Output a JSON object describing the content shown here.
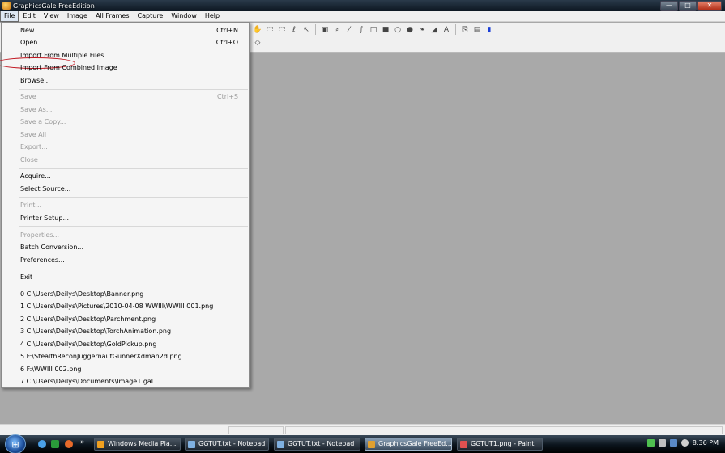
{
  "window": {
    "title": "GraphicsGale FreeEdition",
    "buttons": {
      "minimize": "—",
      "maximize": "□",
      "close": "✕"
    }
  },
  "menubar": {
    "items": [
      "File",
      "Edit",
      "View",
      "Image",
      "All Frames",
      "Capture",
      "Window",
      "Help"
    ]
  },
  "file_menu": {
    "items": [
      {
        "label": "New...",
        "shortcut": "Ctrl+N",
        "enabled": true
      },
      {
        "label": "Open...",
        "shortcut": "Ctrl+O",
        "enabled": true
      },
      {
        "label": "Import From Multiple Files",
        "shortcut": "",
        "enabled": true
      },
      {
        "label": "Import From Combined Image",
        "shortcut": "",
        "enabled": true
      },
      {
        "label": "Browse...",
        "shortcut": "",
        "enabled": true
      },
      {
        "label": "Save",
        "shortcut": "Ctrl+S",
        "enabled": false
      },
      {
        "label": "Save As...",
        "shortcut": "",
        "enabled": false
      },
      {
        "label": "Save a Copy...",
        "shortcut": "",
        "enabled": false
      },
      {
        "label": "Save All",
        "shortcut": "",
        "enabled": false
      },
      {
        "label": "Export...",
        "shortcut": "",
        "enabled": false
      },
      {
        "label": "Close",
        "shortcut": "",
        "enabled": false
      },
      {
        "label": "Acquire...",
        "shortcut": "",
        "enabled": true
      },
      {
        "label": "Select Source...",
        "shortcut": "",
        "enabled": true
      },
      {
        "label": "Print...",
        "shortcut": "",
        "enabled": false
      },
      {
        "label": "Printer Setup...",
        "shortcut": "",
        "enabled": true
      },
      {
        "label": "Properties...",
        "shortcut": "",
        "enabled": false
      },
      {
        "label": "Batch Conversion...",
        "shortcut": "",
        "enabled": true
      },
      {
        "label": "Preferences...",
        "shortcut": "",
        "enabled": true
      },
      {
        "label": "Exit",
        "shortcut": "",
        "enabled": true
      }
    ],
    "recent_files": [
      "0 C:\\Users\\Deilys\\Desktop\\Banner.png",
      "1 C:\\Users\\Deilys\\Pictures\\2010-04-08 WWIII\\WWIII 001.png",
      "2 C:\\Users\\Deilys\\Desktop\\Parchment.png",
      "3 C:\\Users\\Deilys\\Desktop\\TorchAnimation.png",
      "4 C:\\Users\\Deilys\\Desktop\\GoldPickup.png",
      "5 F:\\StealthReconJuggernautGunnerXdman2d.png",
      "6 F:\\WWIII 002.png",
      "7 C:\\Users\\Deilys\\Documents\\Image1.gal"
    ]
  },
  "toolbar": {
    "icons": [
      "hand-icon",
      "marquee-rect-icon",
      "marquee-free-icon",
      "lasso-icon",
      "magic-wand-icon",
      "select-icon",
      "dropper-icon",
      "line-icon",
      "curve-icon",
      "rect-outline-icon",
      "rect-fill-icon",
      "ellipse-outline-icon",
      "ellipse-fill-icon",
      "spray-icon",
      "fill-icon",
      "text-icon",
      "stamp-icon",
      "palette-icon",
      "pen-icon"
    ]
  },
  "taskbar": {
    "tasks": [
      {
        "label": "Windows Media Pla...",
        "active": false,
        "color": "#f0a020"
      },
      {
        "label": "GGTUT.txt - Notepad",
        "active": false,
        "color": "#7fb0e0"
      },
      {
        "label": "GGTUT.txt - Notepad",
        "active": false,
        "color": "#7fb0e0"
      },
      {
        "label": "GraphicsGale FreeEd...",
        "active": true,
        "color": "#e0a030"
      },
      {
        "label": "GGTUT1.png - Paint",
        "active": false,
        "color": "#e05050"
      }
    ],
    "overflow": "»",
    "clock": "8:36 PM"
  },
  "colors": {
    "accent_oval": "#c0141e",
    "workarea": "#a9a9a9"
  }
}
